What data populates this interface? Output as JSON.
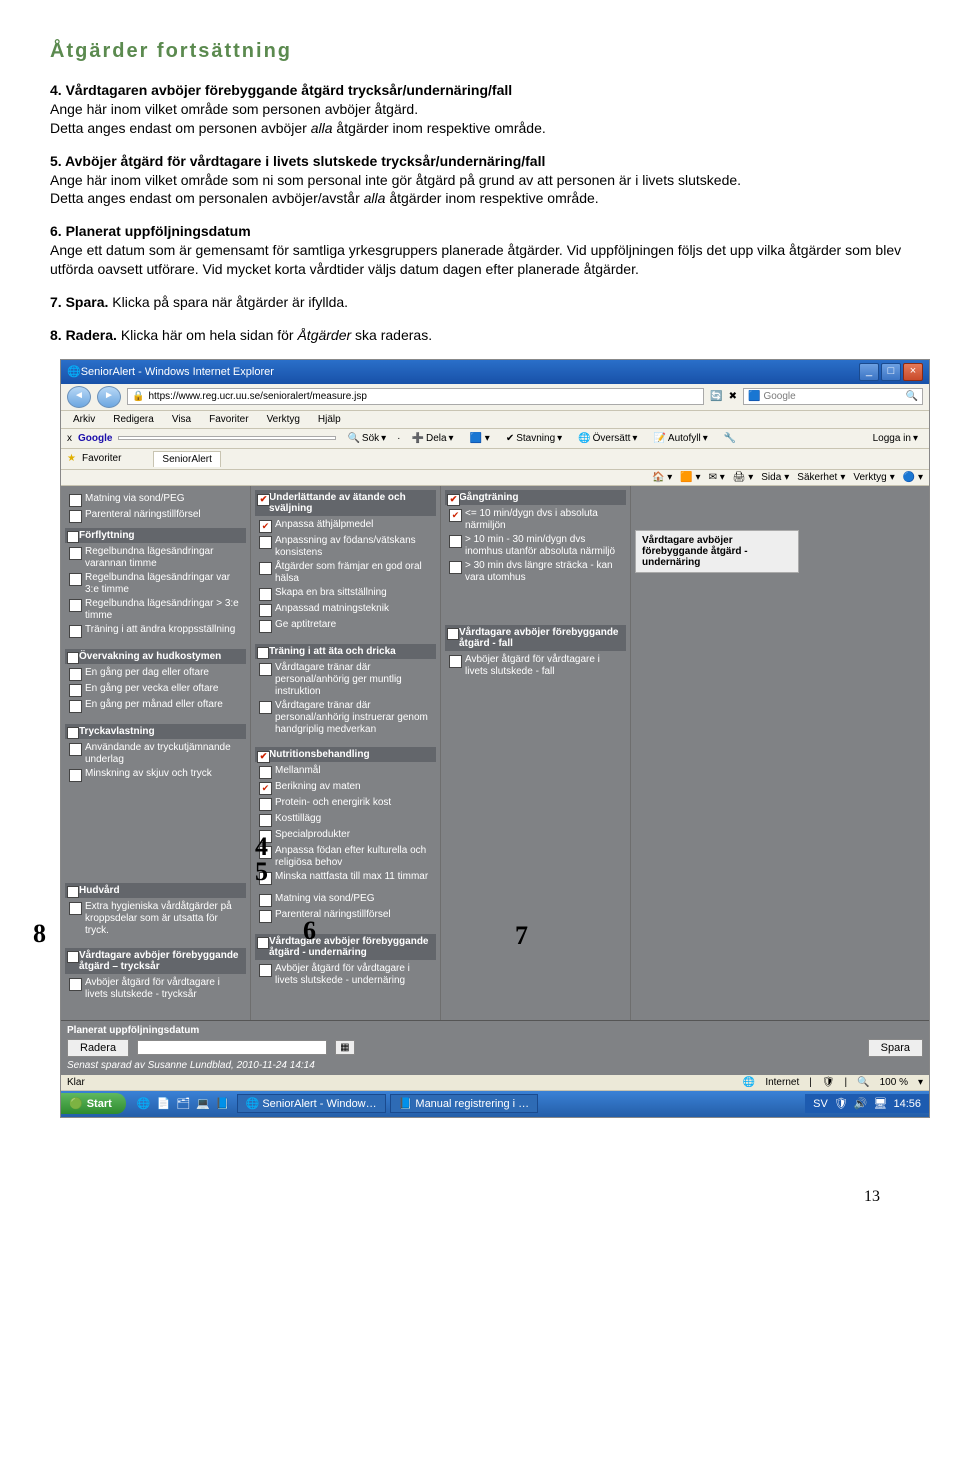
{
  "doc": {
    "title": "Åtgärder fortsättning",
    "p4_lead": "4. Vårdtagaren avböjer förebyggande åtgärd trycksår/undernäring/fall",
    "p4_rest1": "Ange här inom vilket område som personen avböjer åtgärd.",
    "p4_rest2a": "Detta anges endast om personen avböjer ",
    "p4_rest2_it": "alla",
    "p4_rest2b": " åtgärder inom respektive område.",
    "p5_lead": "5. Avböjer åtgärd för vårdtagare i livets slutskede trycksår/undernäring/fall",
    "p5_rest1": "Ange här inom vilket område som ni som personal inte gör åtgärd på grund av att personen är i livets slutskede.",
    "p5_rest2a": "Detta anges endast om personalen avböjer/avstår ",
    "p5_rest2_it": "alla",
    "p5_rest2b": " åtgärder inom respektive område.",
    "p6_lead": "6. Planerat uppföljningsdatum",
    "p6_rest": "Ange ett datum som är gemensamt för samtliga yrkesgruppers planerade åtgärder. Vid uppföljningen följs det upp vilka åtgärder som blev utförda oavsett utförare. Vid mycket korta vårdtider väljs datum dagen efter planerade åtgärder.",
    "p7a": "7. Spara.",
    "p7b": " Klicka på spara när åtgärder är ifyllda.",
    "p8a": "8. Radera.",
    "p8b": " Klicka här om hela sidan för ",
    "p8_it": "Åtgärder",
    "p8c": " ska raderas.",
    "page_number": "13"
  },
  "win": {
    "title": "SeniorAlert - Windows Internet Explorer",
    "url": "https://www.reg.ucr.uu.se/senioralert/measure.jsp",
    "search_hint": "Google",
    "menu": [
      "Arkiv",
      "Redigera",
      "Visa",
      "Favoriter",
      "Verktyg",
      "Hjälp"
    ],
    "gbar": {
      "prefix": "x ",
      "label": "Google",
      "input": "",
      "sok": "Sök",
      "dela": "Dela",
      "stavning": "Stavning",
      "oversatt": "Översätt",
      "autofyll": "Autofyll",
      "logga": "Logga in"
    },
    "fav": {
      "label": "Favoriter",
      "tab": "SeniorAlert"
    },
    "cmd": {
      "sida": "Sida",
      "sakerhet": "Säkerhet",
      "verktyg": "Verktyg"
    },
    "status": {
      "klar": "Klar",
      "internet": "Internet",
      "zoom": "100 %"
    },
    "taskbar": {
      "start": "Start",
      "task1": "SeniorAlert - Window…",
      "task2": "Manual registrering i …",
      "lang": "SV",
      "clock": "14:56"
    }
  },
  "form": {
    "col1": {
      "top_items": [
        "Matning via sond/PEG",
        "Parenteral näringstillförsel"
      ],
      "forflyttning": {
        "title": "Förflyttning",
        "items": [
          "Regelbundna lägesändringar varannan timme",
          "Regelbundna lägesändringar var 3:e timme",
          "Regelbundna lägesändringar > 3:e timme",
          "Träning i att ändra kroppsställning"
        ]
      },
      "overvak": {
        "title": "Övervakning av hudkostymen",
        "items": [
          "En gång per dag eller oftare",
          "En gång per vecka eller oftare",
          "En gång per månad eller oftare"
        ]
      },
      "tryck": {
        "title": "Tryckavlastning",
        "items": [
          "Användande av tryckutjämnande underlag",
          "Minskning av skjuv och tryck"
        ]
      },
      "hud": {
        "title": "Hudvård",
        "items": [
          "Extra hygieniska vårdåtgärder på kroppsdelar som är utsatta för tryck."
        ]
      },
      "tryck_reject": {
        "title": "Vårdtagare avböjer förebyggande åtgärd – trycksår",
        "items": [
          "Avböjer åtgärd för vårdtagare i livets slutskede - trycksår"
        ]
      }
    },
    "col2": {
      "under": {
        "title": "Underlättande av ätande och sväljning",
        "title_checked": true,
        "items": [
          {
            "t": "Anpassa äthjälpmedel",
            "c": true
          },
          {
            "t": "Anpassning av födans/vätskans konsistens",
            "c": false
          },
          {
            "t": "Åtgärder som främjar en god oral hälsa",
            "c": false
          },
          {
            "t": "Skapa en bra sittställning",
            "c": false
          },
          {
            "t": "Anpassad matningsteknik",
            "c": false
          },
          {
            "t": "Ge aptitretare",
            "c": false
          }
        ]
      },
      "train": {
        "title": "Träning i att äta och dricka",
        "items": [
          "Vårdtagare tränar där personal/anhörig ger muntlig instruktion",
          "Vårdtagare tränar där personal/anhörig instruerar genom handgriplig medverkan"
        ]
      },
      "nutri": {
        "title": "Nutritionsbehandling",
        "title_checked": true,
        "items": [
          {
            "t": "Mellanmål",
            "c": false
          },
          {
            "t": "Berikning av maten",
            "c": true
          },
          {
            "t": "Protein- och energirik kost",
            "c": false
          },
          {
            "t": "Kosttillägg",
            "c": false
          },
          {
            "t": "Specialprodukter",
            "c": false
          },
          {
            "t": "Anpassa födan efter kulturella och religiösa behov",
            "c": false
          },
          {
            "t": "Minska nattfasta till max 11 timmar",
            "c": false
          },
          {
            "t": "Matning via sond/PEG",
            "c": false
          },
          {
            "t": "Parenteral näringstillförsel",
            "c": false
          }
        ]
      },
      "und_reject": {
        "title": "Vårdtagare avböjer förebyggande åtgärd - undernäring",
        "items": [
          "Avböjer åtgärd för vårdtagare i livets slutskede - undernäring"
        ]
      }
    },
    "col3": {
      "gang": {
        "title": "Gångträning",
        "title_checked": true,
        "items": [
          {
            "t": "<= 10 min/dygn dvs i absoluta närmiljön",
            "c": true
          },
          {
            "t": "> 10 min - 30 min/dygn dvs inomhus utanför absoluta närmiljö",
            "c": false
          },
          {
            "t": "> 30 min dvs längre sträcka - kan vara utomhus",
            "c": false
          }
        ]
      },
      "fall_reject": {
        "title": "Vårdtagare avböjer förebyggande åtgärd - fall",
        "items": [
          "Avböjer åtgärd för vårdtagare i livets slutskede - fall"
        ]
      }
    },
    "col4": {
      "note": "Vårdtagare avböjer förebyggande åtgärd - undernäring"
    },
    "bottom": {
      "plan_lbl": "Planerat uppföljningsdatum",
      "radera": "Radera",
      "spara": "Spara",
      "saved": "Senast sparad av Susanne Lundblad, 2010-11-24 14:14"
    }
  },
  "overlays": {
    "n4": "4",
    "n5": "5",
    "n6": "6",
    "n7": "7",
    "n8": "8"
  }
}
